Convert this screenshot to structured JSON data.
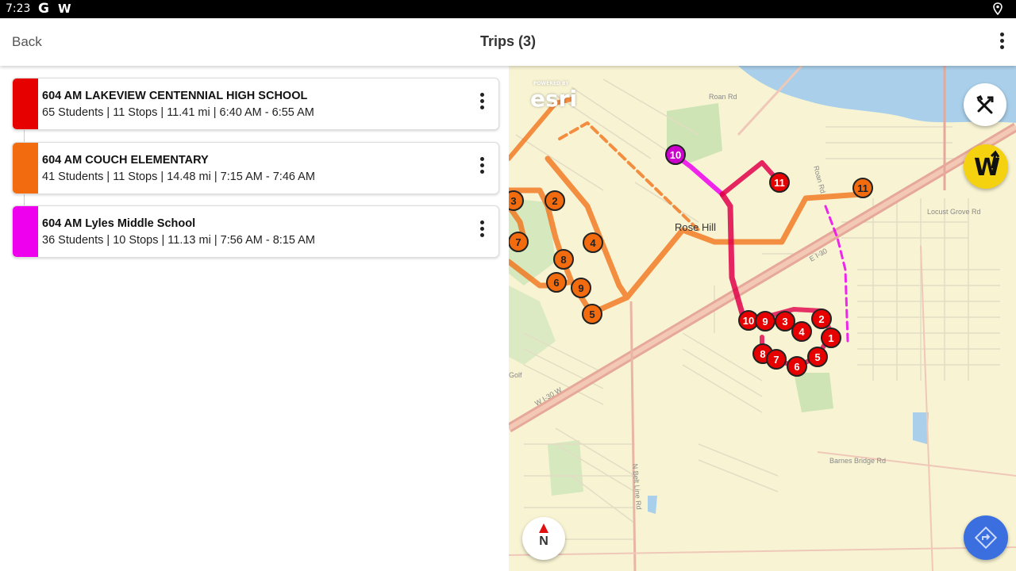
{
  "status_bar": {
    "time": "7:23",
    "app_icon_1": "G",
    "app_icon_2": "W",
    "location_icon": "location-pin-icon"
  },
  "app_bar": {
    "back_label": "Back",
    "title": "Trips (3)",
    "menu_icon": "more-vert-icon"
  },
  "trips": [
    {
      "name": "604 AM LAKEVIEW CENTENNIAL HIGH SCHOOL",
      "meta": "65 Students | 11 Stops | 11.41 mi | 6:40 AM - 6:55 AM",
      "color": "#e60000"
    },
    {
      "name": "604 AM COUCH ELEMENTARY",
      "meta": "41 Students | 11 Stops | 14.48 mi | 7:15 AM - 7:46 AM",
      "color": "#f26b0f"
    },
    {
      "name": "604 AM Lyles Middle School",
      "meta": "36 Students | 10 Stops | 11.13 mi | 7:56 AM - 8:15 AM",
      "color": "#ee00ee"
    }
  ],
  "map": {
    "attribution_small": "POWERED BY",
    "attribution": "esri",
    "place_label": "Rose Hill",
    "road_labels": [
      "Roan Rd",
      "Locust Grove Rd",
      "Barnes Bridge Rd",
      "N Belt Line Rd",
      "E I-30",
      "W I-30 W",
      "Golf",
      "Roan Rd"
    ],
    "compass_label": "N",
    "tools_icon": "tools-icon",
    "waze_icon": "W",
    "nav_icon": "navigation-icon",
    "stops": {
      "orange": [
        "3",
        "2",
        "4",
        "7",
        "8",
        "6",
        "9",
        "5",
        "11"
      ],
      "red": [
        "11",
        "10",
        "9",
        "3",
        "2",
        "4",
        "1",
        "8",
        "7",
        "6",
        "5"
      ],
      "magenta": [
        "10"
      ]
    }
  }
}
